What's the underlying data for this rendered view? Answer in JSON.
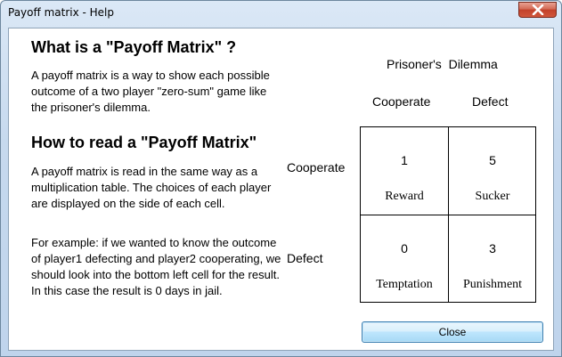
{
  "window": {
    "title": "Payoff matrix - Help"
  },
  "section1": {
    "heading": "What is a \"Payoff Matrix\" ?",
    "lines": [
      "A payoff matrix is a way to show each possible",
      "outcome of a two player \"zero-sum\" game like",
      "the prisoner's dilemma."
    ]
  },
  "section2": {
    "heading": "How to read a \"Payoff Matrix\"",
    "para1_lines": [
      "A payoff matrix is read in the same way as a",
      "multiplication table. The choices of each player",
      "are displayed on the side of each cell."
    ],
    "para2_lines": [
      "For example: if we wanted to know the outcome",
      "of player1 defecting and player2 cooperating, we",
      "should look into the bottom left cell for the result.",
      "In this case the result is 0 days in jail."
    ]
  },
  "matrix": {
    "title": "Prisoner's  Dilemma",
    "columns": [
      "Cooperate",
      "Defect"
    ],
    "rows": [
      "Cooperate",
      "Defect"
    ],
    "cells": [
      {
        "value": "1",
        "outcome": "Reward"
      },
      {
        "value": "5",
        "outcome": "Sucker"
      },
      {
        "value": "0",
        "outcome": "Temptation"
      },
      {
        "value": "3",
        "outcome": "Punishment"
      }
    ]
  },
  "buttons": {
    "close_label": "Close"
  },
  "colors": {
    "close_button_border": "#3c7fb1",
    "titlebar_close": "#c2412a"
  },
  "icons": {
    "titlebar_close": "close-icon"
  }
}
